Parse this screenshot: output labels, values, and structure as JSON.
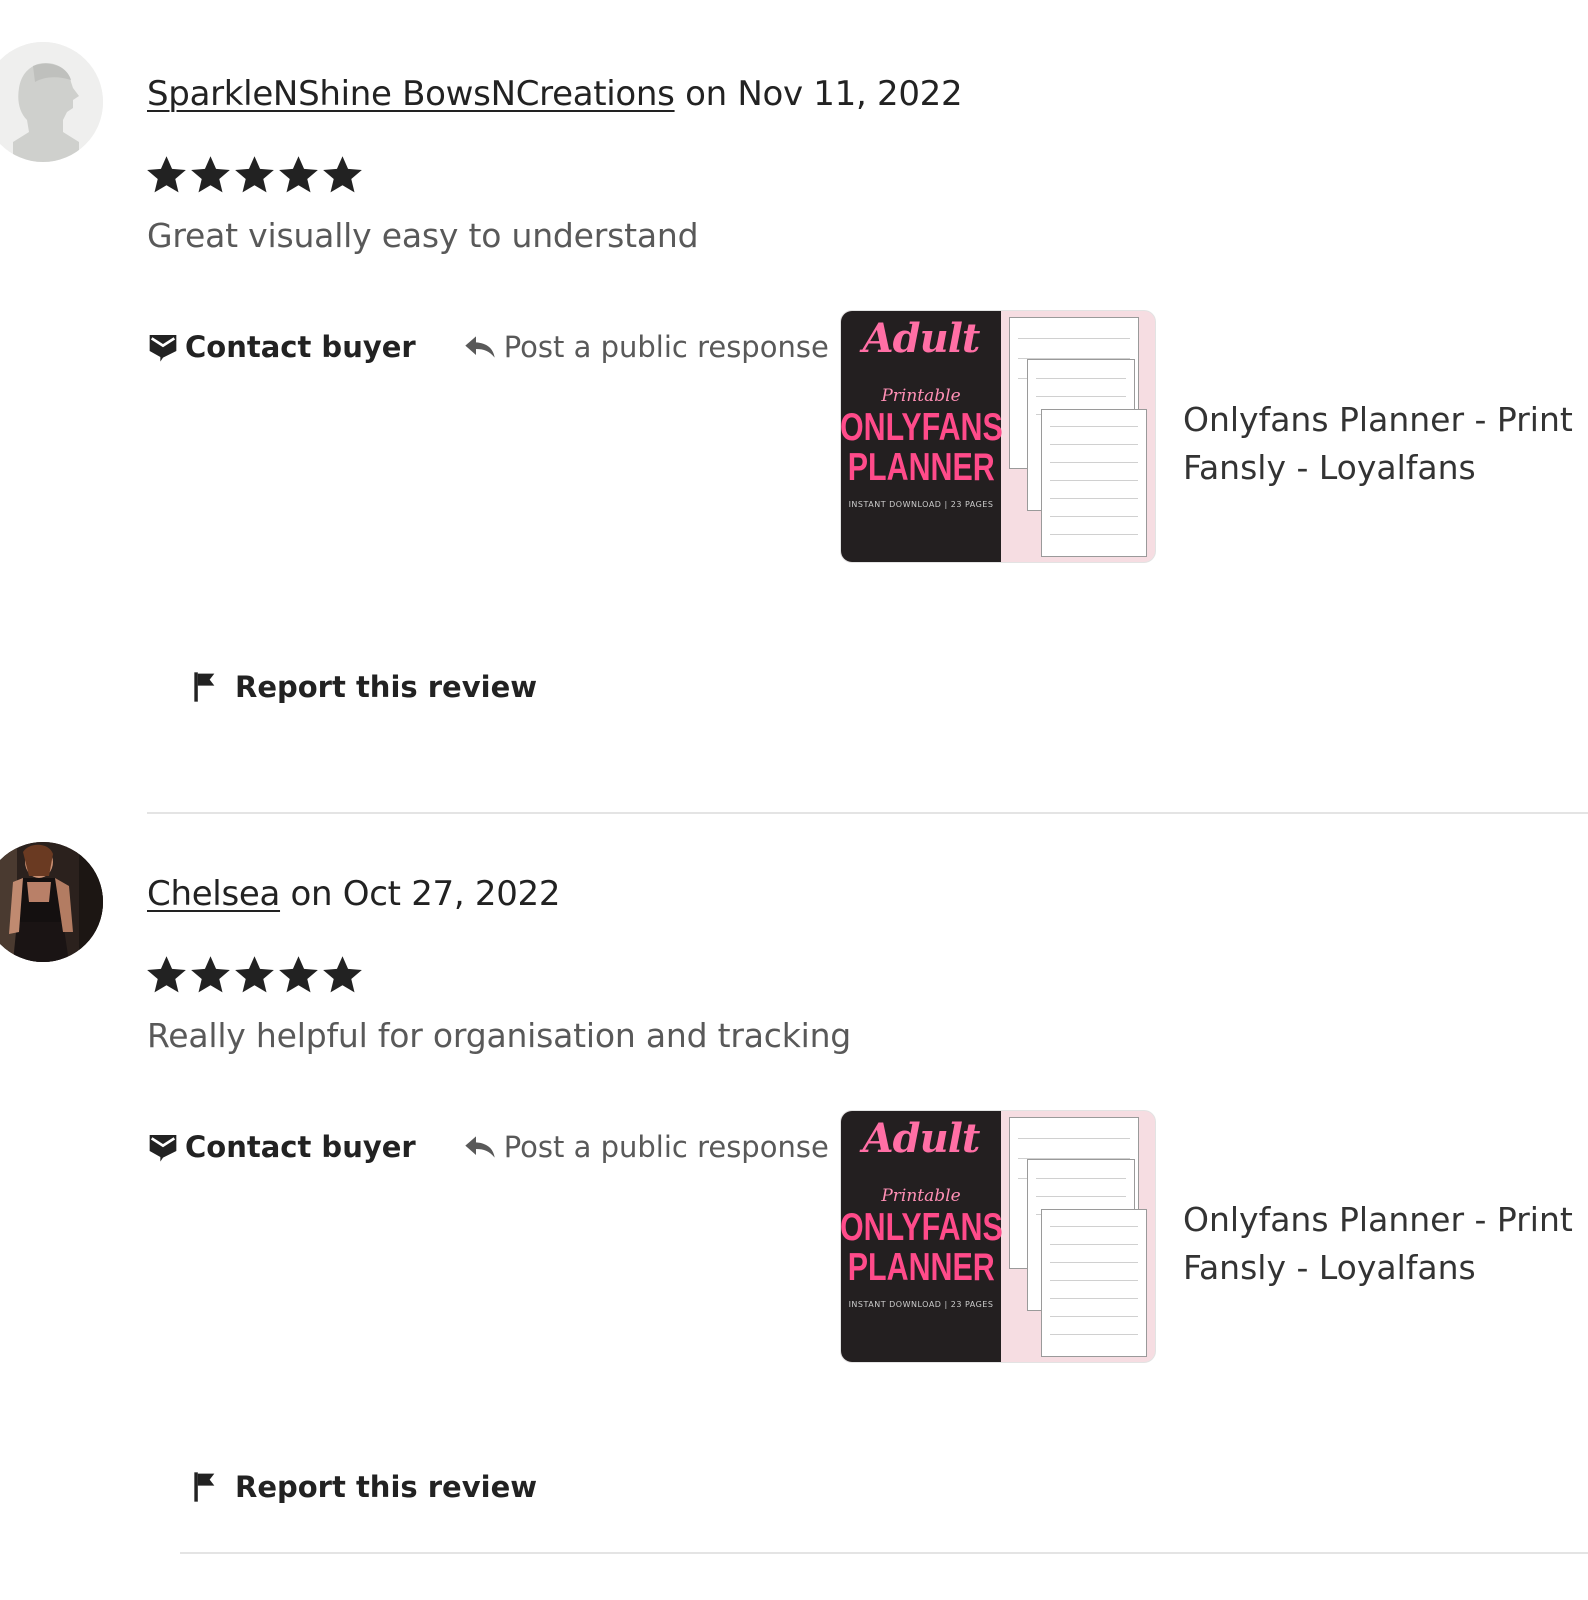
{
  "reviews": [
    {
      "reviewer": "SparkleNShine BowsNCreations",
      "date_text": " on Nov 11, 2022",
      "rating": 5,
      "text": "Great visually easy to understand",
      "avatar": "default-silhouette",
      "item_title_line1": "Onlyfans Planner - Print",
      "item_title_line2": "Fansly - Loyalfans"
    },
    {
      "reviewer": "Chelsea",
      "date_text": " on Oct 27, 2022",
      "rating": 5,
      "text": "Really helpful for organisation and tracking",
      "avatar": "user-photo",
      "item_title_line1": "Onlyfans Planner - Print",
      "item_title_line2": "Fansly - Loyalfans"
    }
  ],
  "actions": {
    "contact_buyer": "Contact buyer",
    "post_response": "Post a public response",
    "report": "Report this review"
  },
  "thumbnail": {
    "brand": "Adult",
    "script": "Printable",
    "line1": "ONLYFANS",
    "line2": "PLANNER",
    "small": "INSTANT DOWNLOAD | 23 PAGES"
  },
  "colors": {
    "text": "#222222",
    "muted": "#595959",
    "thumb_pink": "#ff4b8a",
    "thumb_dark": "#231f20",
    "divider": "#e4e4e4"
  }
}
